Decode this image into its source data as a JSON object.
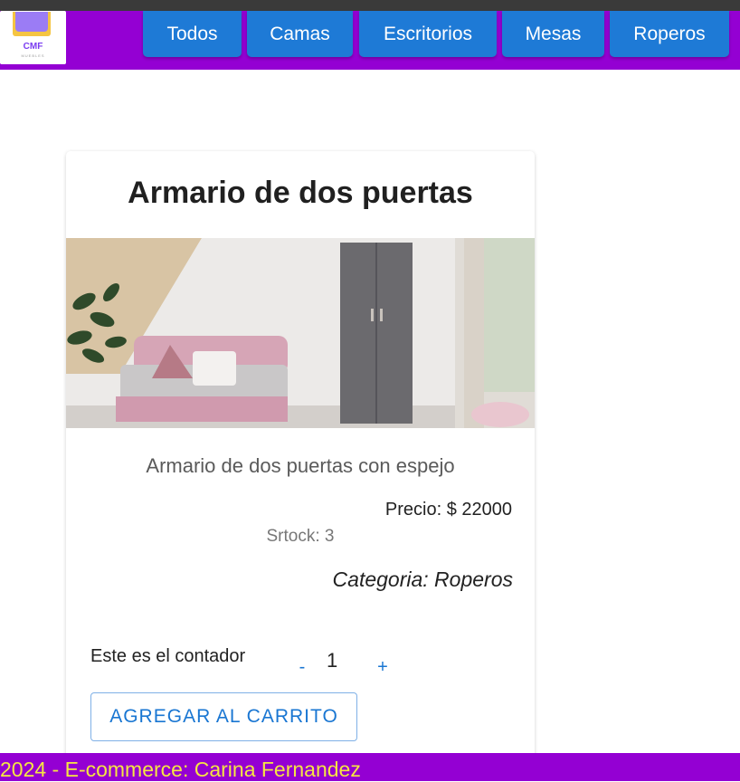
{
  "header": {
    "logo": {
      "brand": "CMF",
      "sub": "MUEBLES"
    },
    "nav": [
      {
        "label": "Todos"
      },
      {
        "label": "Camas"
      },
      {
        "label": "Escritorios"
      },
      {
        "label": "Mesas"
      },
      {
        "label": "Roperos"
      }
    ]
  },
  "product": {
    "title": "Armario de dos puertas",
    "description": "Armario de dos puertas con espejo",
    "price": "Precio: $ 22000",
    "stock": "Srtock: 3",
    "category": "Categoria: Roperos"
  },
  "counter": {
    "label": "Este es el contador",
    "minus": "-",
    "value": "1",
    "plus": "+"
  },
  "add_to_cart": "AGREGAR AL CARRITO",
  "footer": {
    "text": "2024 - E-commerce: Carina Fernandez"
  },
  "colors": {
    "brand_purple": "#9400d3",
    "nav_blue": "#1e7ad6",
    "footer_yellow": "#f5e642"
  }
}
